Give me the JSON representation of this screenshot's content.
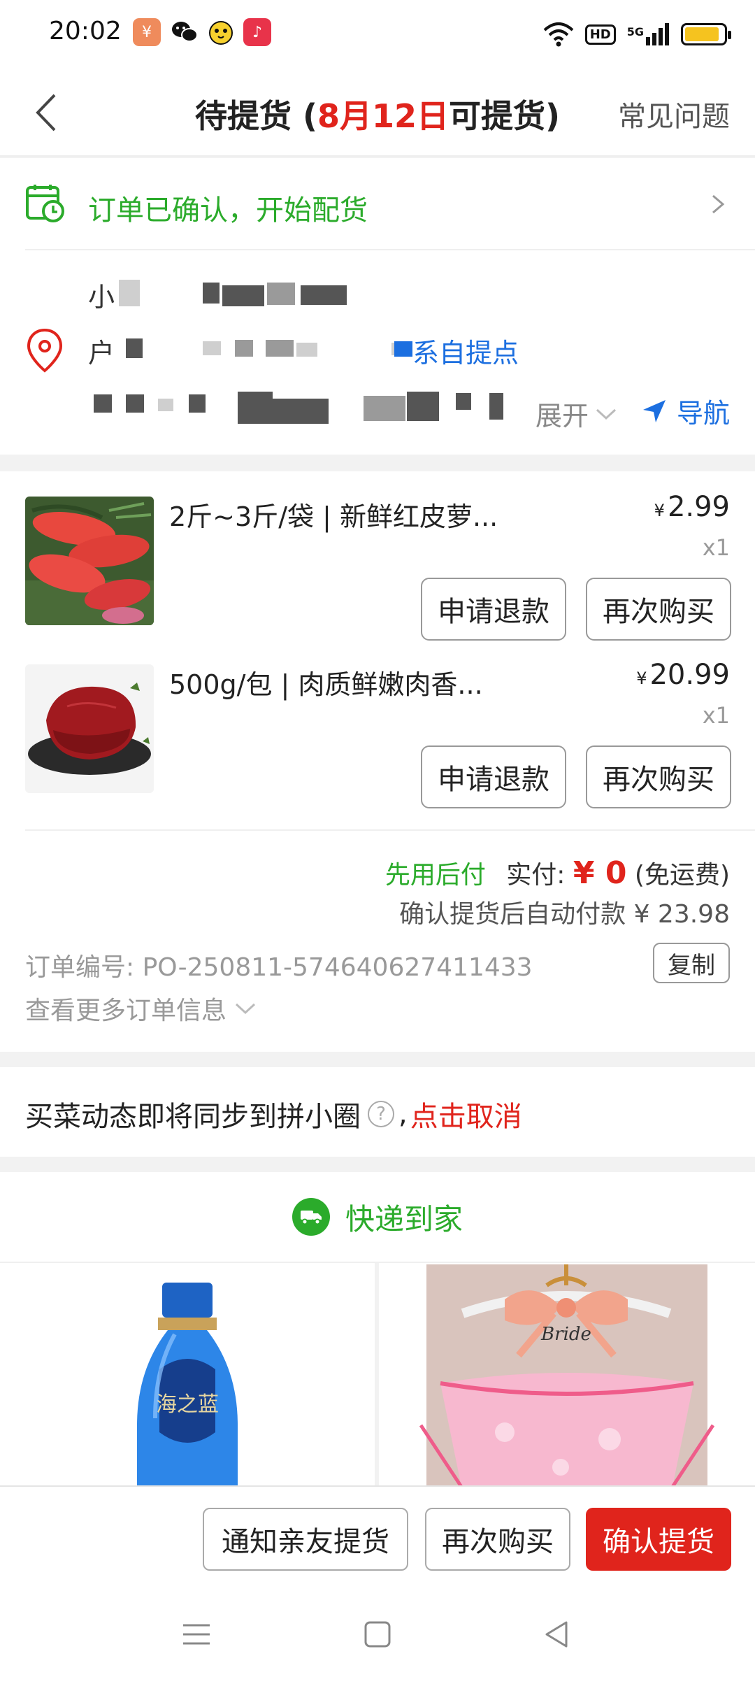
{
  "status_bar": {
    "time": "20:02",
    "apps": [
      {
        "icon": "taobao-app-icon",
        "glyph": "¥",
        "color": "#ef8b5c"
      },
      {
        "icon": "wechat-app-icon",
        "glyph": "",
        "color": "#ffffff"
      },
      {
        "icon": "chick-app-icon",
        "glyph": "",
        "color": "#ffffff"
      },
      {
        "icon": "music-app-icon",
        "glyph": "♪",
        "color": "#e8334a"
      }
    ],
    "hd_label": "HD",
    "signal_label": "5G"
  },
  "header": {
    "title_prefix": "待提货 (",
    "title_date": "8月12日",
    "title_suffix": "可提货)",
    "faq_label": "常见问题"
  },
  "order_status": {
    "text": "订单已确认，开始配货"
  },
  "address": {
    "name_visible": "小",
    "line2_visible": "户",
    "pickup_link": "系自提点",
    "expand_label": "展开",
    "navigate_label": "导航"
  },
  "items": [
    {
      "title": "2斤~3斤/袋 | 新鲜红皮萝...",
      "currency": "¥",
      "price": "2.99",
      "qty": "x1",
      "refund_label": "申请退款",
      "rebuy_label": "再次购买"
    },
    {
      "title": "500g/包 | 肉质鲜嫩肉香...",
      "currency": "¥",
      "price": "20.99",
      "qty": "x1",
      "refund_label": "申请退款",
      "rebuy_label": "再次购买"
    }
  ],
  "payment": {
    "pay_later": "先用后付",
    "actual_label": "实付:",
    "amount": "¥ 0",
    "shipping_note": "(免运费)",
    "auto_pay_note": "确认提货后自动付款 ¥ 23.98"
  },
  "order_info": {
    "order_no": "订单编号:  PO-250811-574640627411433",
    "copy_label": "复制",
    "more_info": "查看更多订单信息"
  },
  "sync": {
    "text": "买菜动态即将同步到拼小圈",
    "comma": ",",
    "cancel_label": "点击取消"
  },
  "express": {
    "label": "快递到家"
  },
  "actions": {
    "notify_label": "通知亲友提货",
    "rebuy_label": "再次购买",
    "confirm_label": "确认提货"
  },
  "colors": {
    "accent_red": "#e0241c",
    "accent_green": "#2bab2b",
    "link_blue": "#1c6fe0"
  }
}
